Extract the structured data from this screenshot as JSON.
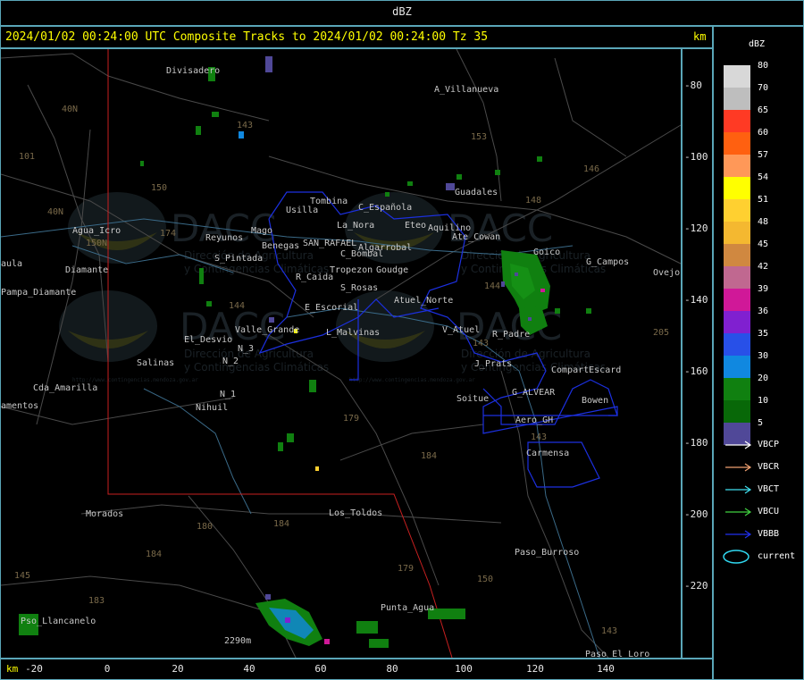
{
  "header": {
    "product": "dBZ"
  },
  "title": "2024/01/02 00:24:00 UTC Composite Tracks to 2024/01/02 00:24:00 Tz 35",
  "axes": {
    "unit": "km",
    "y_ticks": [
      "-80",
      "-100",
      "-120",
      "-140",
      "-160",
      "-180",
      "-200",
      "-220"
    ],
    "x_ticks": [
      "-20",
      "0",
      "20",
      "40",
      "60",
      "80",
      "100",
      "120",
      "140"
    ]
  },
  "legend": {
    "title": "dBZ",
    "scale": [
      {
        "label": "80",
        "color": "#d8d8d8"
      },
      {
        "label": "70",
        "color": "#bebebe"
      },
      {
        "label": "65",
        "color": "#ff3a24"
      },
      {
        "label": "60",
        "color": "#ff6010"
      },
      {
        "label": "57",
        "color": "#ff9858"
      },
      {
        "label": "54",
        "color": "#ffff00"
      },
      {
        "label": "51",
        "color": "#ffd030"
      },
      {
        "label": "48",
        "color": "#f4b830"
      },
      {
        "label": "45",
        "color": "#d08840"
      },
      {
        "label": "42",
        "color": "#c06890"
      },
      {
        "label": "39",
        "color": "#d01898"
      },
      {
        "label": "36",
        "color": "#8020d0"
      },
      {
        "label": "35",
        "color": "#2850e8"
      },
      {
        "label": "30",
        "color": "#1088e0"
      },
      {
        "label": "20",
        "color": "#108010"
      },
      {
        "label": "10",
        "color": "#086808"
      },
      {
        "label": "5",
        "color": "#504898"
      }
    ],
    "tracks": [
      {
        "label": "VBCP",
        "color": "#ffffff"
      },
      {
        "label": "VBCR",
        "color": "#f0a070"
      },
      {
        "label": "VBCT",
        "color": "#40e0f0"
      },
      {
        "label": "VBCU",
        "color": "#40d040"
      },
      {
        "label": "VBBB",
        "color": "#2030f0"
      }
    ],
    "current": {
      "label": "current",
      "color": "#30d8f0"
    }
  },
  "places": [
    "Divisadero",
    "A_Villanueva",
    "Tombina",
    "Usilla",
    "C_Española",
    "La_Nora",
    "Eteo",
    "Aquilino",
    "Ate_Cowan",
    "Guadales",
    "Reyunos",
    "Mago",
    "Benegas",
    "SAN_RAFAEL",
    "Algarrobal",
    "C_Bombal",
    "Goudge",
    "Tropezon",
    "R_Caida",
    "S_Rosas",
    "Atuel_Norte",
    "S_Pintada",
    "E_Escorial",
    "Valle_Grande",
    "L_Malvinas",
    "V_Atuel",
    "R_Padre",
    "Goico",
    "G_Campos",
    "Ovejo",
    "El_Desvio",
    "N_2",
    "N_3",
    "N_1",
    "Nihuil",
    "Salinas",
    "J_Prats",
    "CompartEscard",
    "G_ALVEAR",
    "Bowen",
    "Soitue",
    "Aero_GH",
    "Carmensa",
    "Agua_Icro",
    "Diamante",
    "aula",
    "Pampa_Diamante",
    "Cda_Amarilla",
    "amentos",
    "Morados",
    "Los_Toldos",
    "Paso_Burroso",
    "Punta_Agua",
    "Pso_Llancanelo",
    "Paso_El_Loro",
    "2290m"
  ],
  "route_numbers": [
    "101",
    "40N",
    "150",
    "143",
    "153",
    "146",
    "148",
    "144",
    "174",
    "40N",
    "150N",
    "179",
    "184",
    "184",
    "184",
    "183",
    "180",
    "179",
    "150",
    "143",
    "143",
    "205",
    "144",
    "143",
    "145"
  ],
  "watermark": {
    "logo": "DACC",
    "line1": "Dirección de Agricultura",
    "line2": "y Contingencias Climáticas",
    "url": "http://www.contingencias.mendoza.gov.ar"
  }
}
